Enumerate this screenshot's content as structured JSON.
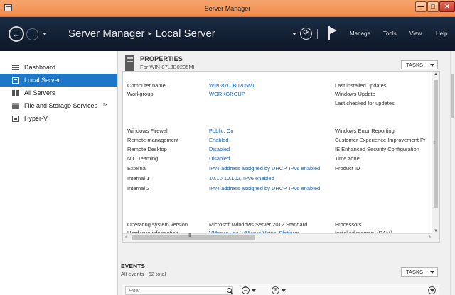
{
  "window": {
    "title": "Server Manager",
    "buttons": {
      "minimize": "—",
      "maximize": "□",
      "close": "✕"
    }
  },
  "header": {
    "breadcrumb": [
      "Server Manager",
      "Local Server"
    ],
    "breadcrumb_separator": "▸",
    "refresh_glyph": "⟳",
    "menu": {
      "manage": "Manage",
      "tools": "Tools",
      "view": "View",
      "help": "Help"
    }
  },
  "sidebar": {
    "items": [
      {
        "label": "Dashboard",
        "icon": "dashboard-icon"
      },
      {
        "label": "Local Server",
        "icon": "local-server-icon",
        "active": true
      },
      {
        "label": "All Servers",
        "icon": "all-servers-icon"
      },
      {
        "label": "File and Storage Services",
        "icon": "file-storage-icon",
        "arrow": "ᐅ"
      },
      {
        "label": "Hyper-V",
        "icon": "hyper-v-icon"
      }
    ]
  },
  "properties": {
    "title": "PROPERTIES",
    "subtitle": "For WIN-87LJB0205MI",
    "tasks_label": "TASKS",
    "rows": [
      {
        "label": "Computer name",
        "value": "WIN-87LJB0205MI"
      },
      {
        "label": "Workgroup",
        "value": "WORKGROUP"
      },
      {
        "label": "Windows Firewall",
        "value": "Public: On"
      },
      {
        "label": "Remote management",
        "value": "Enabled"
      },
      {
        "label": "Remote Desktop",
        "value": "Disabled"
      },
      {
        "label": "NIC Teaming",
        "value": "Disabled"
      },
      {
        "label": "External",
        "value": "IPv4 address assigned by DHCP, IPv6 enabled"
      },
      {
        "label": "Internal 1",
        "value": "10.10.10.102, IPv6 enabled"
      },
      {
        "label": "Internal 2",
        "value": "IPv4 address assigned by DHCP, IPv6 enabled"
      },
      {
        "label": "Operating system version",
        "value": "Microsoft Windows Server 2012 Standard"
      },
      {
        "label": "Hardware information",
        "value": "VMware, Inc. VMware Virtual Platform"
      }
    ],
    "right_labels": [
      "Last installed updates",
      "Windows Update",
      "Last checked for updates",
      "Windows Error Reporting",
      "Customer Experience Improvement Pr",
      "IE Enhanced Security Configuration",
      "Time zone",
      "Product ID",
      "Processors",
      "Installed memory (RAM)"
    ],
    "scroll_glyphs": {
      "up": "▲",
      "down": "▼",
      "left": "‹",
      "right": "›",
      "grip_v": "≡",
      "grip_h": "III"
    }
  },
  "events": {
    "title": "EVENTS",
    "subtitle": "All events | 62 total",
    "tasks_label": "TASKS",
    "filter_placeholder": "Filter",
    "btn1_glyph": "☰",
    "btn2_glyph": "⊞"
  }
}
